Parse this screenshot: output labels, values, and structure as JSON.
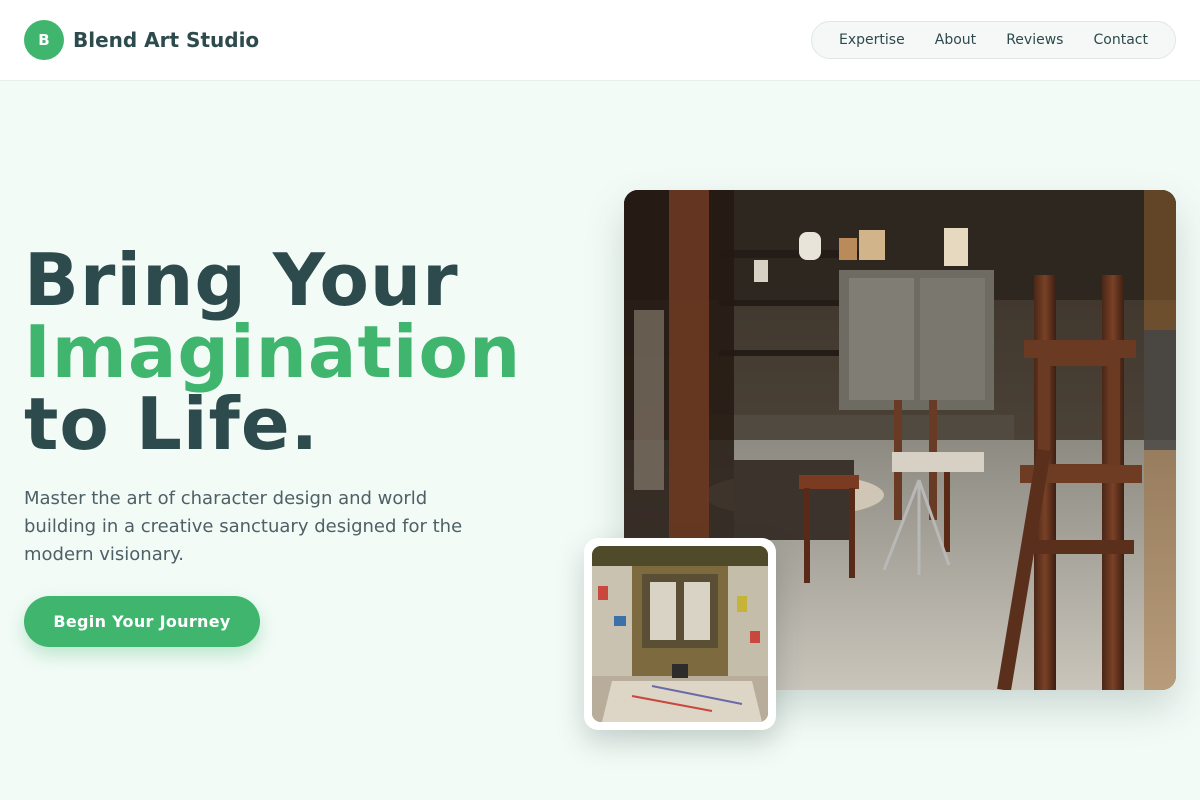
{
  "brand": {
    "initial": "B",
    "name": "Blend Art Studio"
  },
  "nav": {
    "items": [
      "Expertise",
      "About",
      "Reviews",
      "Contact"
    ]
  },
  "hero": {
    "line1": "Bring Your",
    "line2": "Imagination",
    "line3": "to Life.",
    "description": "Master the art of character design and world building in a creative sanctuary designed for the modern visionary.",
    "cta": "Begin Your Journey"
  },
  "colors": {
    "accent": "#3fb56e",
    "text_dark": "#2d4a4c",
    "background": "#f3fbf7"
  }
}
